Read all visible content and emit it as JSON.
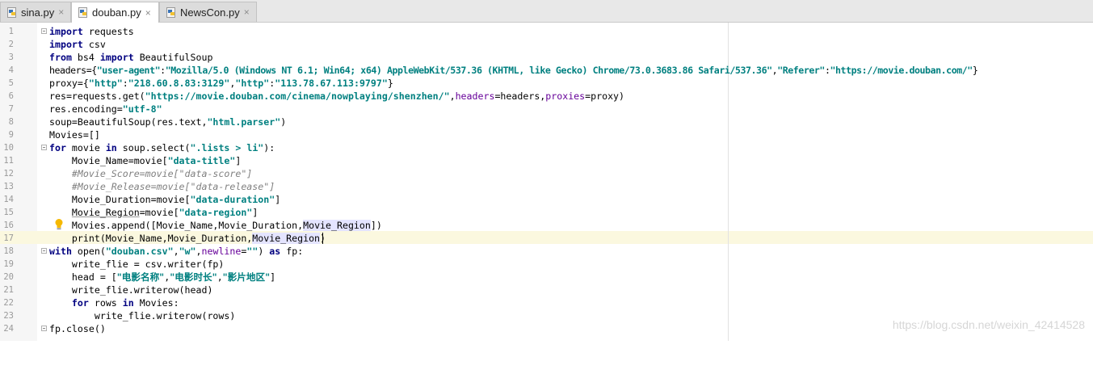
{
  "tabs": [
    {
      "label": "sina.py",
      "active": false,
      "close": "×"
    },
    {
      "label": "douban.py",
      "active": true,
      "close": "×"
    },
    {
      "label": "NewsCon.py",
      "active": false,
      "close": "×"
    }
  ],
  "editor": {
    "line_numbers": [
      "1",
      "2",
      "3",
      "4",
      "5",
      "6",
      "7",
      "8",
      "9",
      "10",
      "11",
      "12",
      "13",
      "14",
      "15",
      "16",
      "17",
      "18",
      "19",
      "20",
      "21",
      "22",
      "23",
      "24"
    ],
    "current_line": 17,
    "watermark": "https://blog.csdn.net/weixin_42414528"
  },
  "code": {
    "l1_kw": "import",
    "l1_rest": " requests",
    "l2_kw": "import",
    "l2_rest": " csv",
    "l3_kw1": "from",
    "l3_mid": " bs4 ",
    "l3_kw2": "import",
    "l3_rest": " BeautifulSoup",
    "l4_a": "headers={",
    "l4_s1": "\"user-agent\"",
    "l4_b": ":",
    "l4_s2": "\"Mozilla/5.0 (Windows NT 6.1; Win64; x64) AppleWebKit/537.36 (KHTML, like Gecko) Chrome/73.0.3683.86 Safari/537.36\"",
    "l4_c": ",",
    "l4_s3": "\"Referer\"",
    "l4_d": ":",
    "l4_s4": "\"https://movie.douban.com/\"",
    "l4_e": "}",
    "l5_a": "proxy={",
    "l5_s1": "\"http\"",
    "l5_b": ":",
    "l5_s2": "\"218.60.8.83:3129\"",
    "l5_c": ",",
    "l5_s3": "\"http\"",
    "l5_d": ":",
    "l5_s4": "\"113.78.67.113:9797\"",
    "l5_e": "}",
    "l6_a": "res=requests.get(",
    "l6_s1": "\"https://movie.douban.com/cinema/nowplaying/shenzhen/\"",
    "l6_b": ",",
    "l6_p1": "headers",
    "l6_c": "=headers,",
    "l6_p2": "proxies",
    "l6_d": "=proxy)",
    "l7_a": "res.encoding=",
    "l7_s1": "\"utf-8\"",
    "l8_a": "soup=BeautifulSoup(res.text,",
    "l8_s1": "\"html.parser\"",
    "l8_b": ")",
    "l9_a": "Movies=[]",
    "l10_kw1": "for",
    "l10_a": " movie ",
    "l10_kw2": "in",
    "l10_b": " soup.select(",
    "l10_s1": "\".lists > li\"",
    "l10_c": "):",
    "l11_a": "    Movie_Name=movie[",
    "l11_s1": "\"data-title\"",
    "l11_b": "]",
    "l12_cm": "    #Movie_Score=movie[\"data-score\"]",
    "l13_cm": "    #Movie_Release=movie[\"data-release\"]",
    "l14_a": "    Movie_Duration=movie[",
    "l14_s1": "\"data-duration\"",
    "l14_b": "]",
    "l15_in": "    ",
    "l15_u": "Movie_Region",
    "l15_a": "=movie[",
    "l15_s1": "\"data-region\"",
    "l15_b": "]",
    "l16_a": "    Movies.append([Movie_Name,Movie_Duration,",
    "l16_h": "Movie_Region",
    "l16_b": "])",
    "l17_a": "    print(Movie_Name,Movie_Duration,",
    "l17_h": "Movie_Region",
    "l17_b": ")",
    "l18_kw1": "with",
    "l18_a": " open(",
    "l18_s1": "\"douban.csv\"",
    "l18_b": ",",
    "l18_s2": "\"w\"",
    "l18_c": ",",
    "l18_p1": "newline",
    "l18_d": "=",
    "l18_s3": "\"\"",
    "l18_e": ") ",
    "l18_kw2": "as",
    "l18_f": " fp:",
    "l19_a": "    write_flie = csv.writer(fp)",
    "l20_a": "    head = [",
    "l20_s1": "\"电影名称\"",
    "l20_b": ",",
    "l20_s2": "\"电影时长\"",
    "l20_c": ",",
    "l20_s3": "\"影片地区\"",
    "l20_d": "]",
    "l21_a": "    write_flie.writerow(head)",
    "l22_in": "    ",
    "l22_kw1": "for",
    "l22_a": " rows ",
    "l22_kw2": "in",
    "l22_b": " Movies:",
    "l23_a": "        write_flie.writerow(rows)",
    "l24_a": "fp.close()"
  }
}
